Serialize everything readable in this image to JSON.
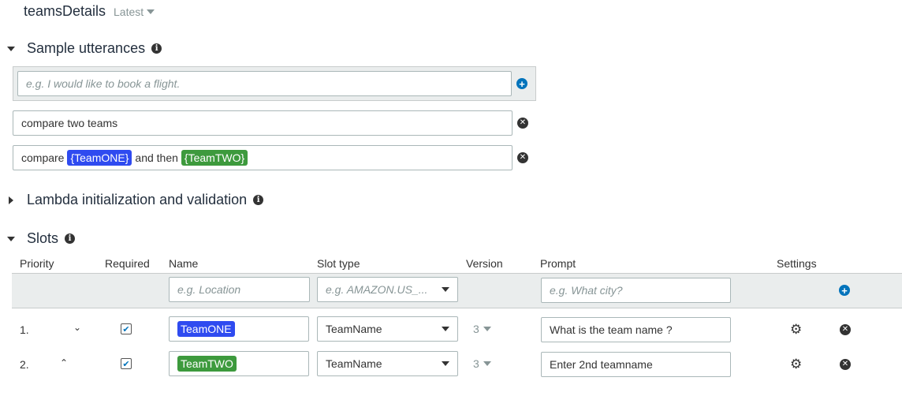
{
  "header": {
    "title": "teamsDetails",
    "version": "Latest"
  },
  "utterances": {
    "title": "Sample utterances",
    "new_placeholder": "e.g. I would like to book a flight.",
    "items": [
      {
        "text": "compare two teams"
      },
      {
        "prefix": "compare",
        "slot1": "{TeamONE}",
        "middle": "and then",
        "slot2": "{TeamTWO}"
      }
    ]
  },
  "lambda": {
    "title": "Lambda initialization and validation"
  },
  "slots": {
    "title": "Slots",
    "columns": [
      "Priority",
      "Required",
      "Name",
      "Slot type",
      "Version",
      "Prompt",
      "Settings"
    ],
    "new_row": {
      "name_placeholder": "e.g. Location",
      "type_placeholder": "e.g. AMAZON.US_...",
      "prompt_placeholder": "e.g. What city?"
    },
    "rows": [
      {
        "priority": "1.",
        "required": true,
        "name": "TeamONE",
        "name_color": "#2f4bf0",
        "type": "TeamName",
        "version": "3",
        "prompt": "What is the team name ?"
      },
      {
        "priority": "2.",
        "required": true,
        "name": "TeamTWO",
        "name_color": "#3d9a3d",
        "type": "TeamName",
        "version": "3",
        "prompt": "Enter 2nd teamname"
      }
    ]
  },
  "colors": {
    "accent": "#0073bb",
    "slot_blue": "#2f4bf0",
    "slot_green": "#3d9a3d"
  }
}
